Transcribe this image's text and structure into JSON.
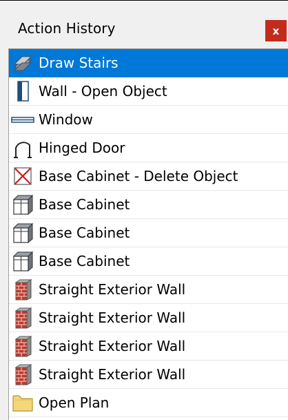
{
  "panel": {
    "title": "Action History",
    "close_label": "x"
  },
  "history": {
    "items": [
      {
        "label": "Draw Stairs",
        "icon": "stairs-icon",
        "selected": true
      },
      {
        "label": "Wall - Open Object",
        "icon": "wall-open-object-icon",
        "selected": false
      },
      {
        "label": "Window",
        "icon": "window-icon",
        "selected": false
      },
      {
        "label": "Hinged Door",
        "icon": "hinged-door-icon",
        "selected": false
      },
      {
        "label": "Base Cabinet - Delete Object",
        "icon": "delete-object-icon",
        "selected": false
      },
      {
        "label": "Base Cabinet",
        "icon": "base-cabinet-icon",
        "selected": false
      },
      {
        "label": "Base Cabinet",
        "icon": "base-cabinet-icon",
        "selected": false
      },
      {
        "label": "Base Cabinet",
        "icon": "base-cabinet-icon",
        "selected": false
      },
      {
        "label": "Straight Exterior Wall",
        "icon": "exterior-wall-icon",
        "selected": false
      },
      {
        "label": "Straight Exterior Wall",
        "icon": "exterior-wall-icon",
        "selected": false
      },
      {
        "label": "Straight Exterior Wall",
        "icon": "exterior-wall-icon",
        "selected": false
      },
      {
        "label": "Straight Exterior Wall",
        "icon": "exterior-wall-icon",
        "selected": false
      },
      {
        "label": "Open Plan",
        "icon": "folder-icon",
        "selected": false
      }
    ]
  },
  "colors": {
    "selection": "#0078d7",
    "close_button": "#c42b1c"
  }
}
